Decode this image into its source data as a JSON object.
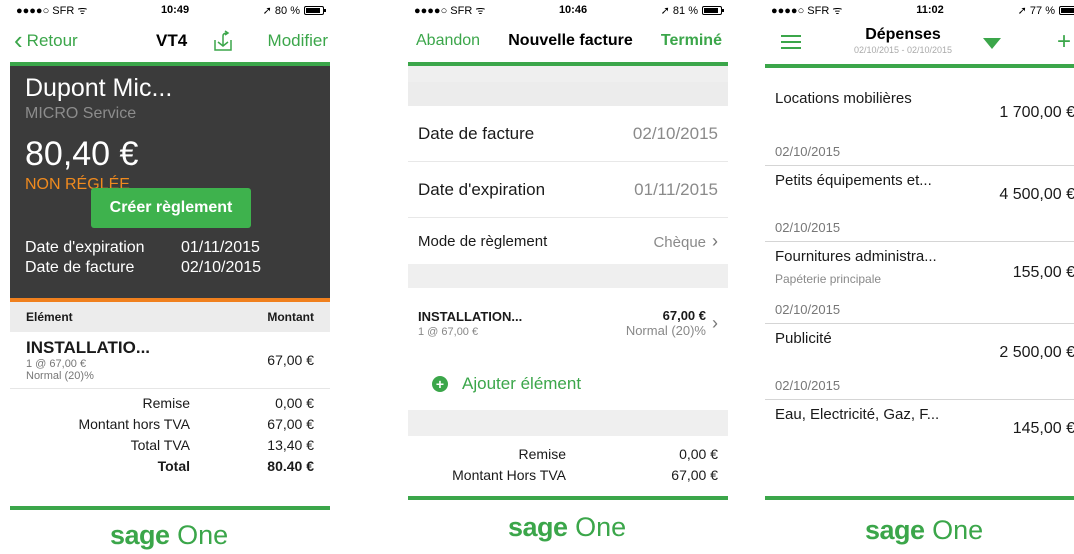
{
  "screen1": {
    "status": {
      "carrier": "●●●●○ SFR ᯤ",
      "time": "10:49",
      "battery": "➚ 80 %",
      "battery_pct": 0.8
    },
    "nav": {
      "back": "Retour",
      "title": "VT4",
      "edit": "Modifier"
    },
    "header": {
      "customer": "Dupont Mic...",
      "company": "MICRO Service",
      "amount": "80,40 €",
      "status": "NON RÉGLÉE",
      "button": "Créer règlement",
      "dates": [
        {
          "label": "Date d'expiration",
          "value": "01/11/2015"
        },
        {
          "label": "Date de facture",
          "value": "02/10/2015"
        }
      ]
    },
    "table": {
      "col1": "Elément",
      "col2": "Montant"
    },
    "item": {
      "name": "INSTALLATIO...",
      "qty": "1 @ 67,00 €",
      "tax": "Normal (20)%",
      "amount": "67,00 €"
    },
    "totals": [
      {
        "label": "Remise",
        "value": "0,00 €"
      },
      {
        "label": "Montant hors TVA",
        "value": "67,00 €"
      },
      {
        "label": "Total TVA",
        "value": "13,40 €"
      },
      {
        "label": "Total",
        "value": "80.40 €"
      }
    ]
  },
  "screen2": {
    "status": {
      "carrier": "●●●●○ SFR ᯤ",
      "time": "10:46",
      "battery": "➚ 81 %",
      "battery_pct": 0.81
    },
    "nav": {
      "cancel": "Abandon",
      "title": "Nouvelle facture",
      "done": "Terminé"
    },
    "fields": [
      {
        "label": "Date de facture",
        "value": "02/10/2015"
      },
      {
        "label": "Date d'expiration",
        "value": "01/11/2015"
      },
      {
        "label": "Mode de règlement",
        "value": "Chèque"
      }
    ],
    "item": {
      "name": "INSTALLATION...",
      "qty": "1 @ 67,00 €",
      "amount": "67,00 €",
      "tax": "Normal (20)%"
    },
    "add_label": "Ajouter élément",
    "totals": [
      {
        "label": "Remise",
        "value": "0,00 €"
      },
      {
        "label": "Montant Hors TVA",
        "value": "67,00 €"
      }
    ]
  },
  "screen3": {
    "status": {
      "carrier": "●●●●○ SFR ᯤ",
      "time": "11:02",
      "battery": "➚ 77 %",
      "battery_pct": 0.77
    },
    "nav": {
      "title": "Dépenses",
      "range": "02/10/2015 - 02/10/2015"
    },
    "expenses": [
      {
        "desc": "Locations mobilières",
        "sub": "",
        "amount": "1 700,00 €",
        "date": "02/10/2015"
      },
      {
        "desc": "Petits équipements et...",
        "sub": "",
        "amount": "4 500,00 €",
        "date": "02/10/2015"
      },
      {
        "desc": "Fournitures administra...",
        "sub": "Papéterie principale",
        "amount": "155,00 €",
        "date": "02/10/2015"
      },
      {
        "desc": "Publicité",
        "sub": "",
        "amount": "2 500,00 €",
        "date": "02/10/2015"
      },
      {
        "desc": "Eau, Electricité, Gaz, F...",
        "sub": "",
        "amount": "145,00 €",
        "date": ""
      }
    ]
  },
  "brand": {
    "sage": "sage",
    "one": "One",
    "color": "#3ba64a",
    "warning": "#f0801e"
  }
}
